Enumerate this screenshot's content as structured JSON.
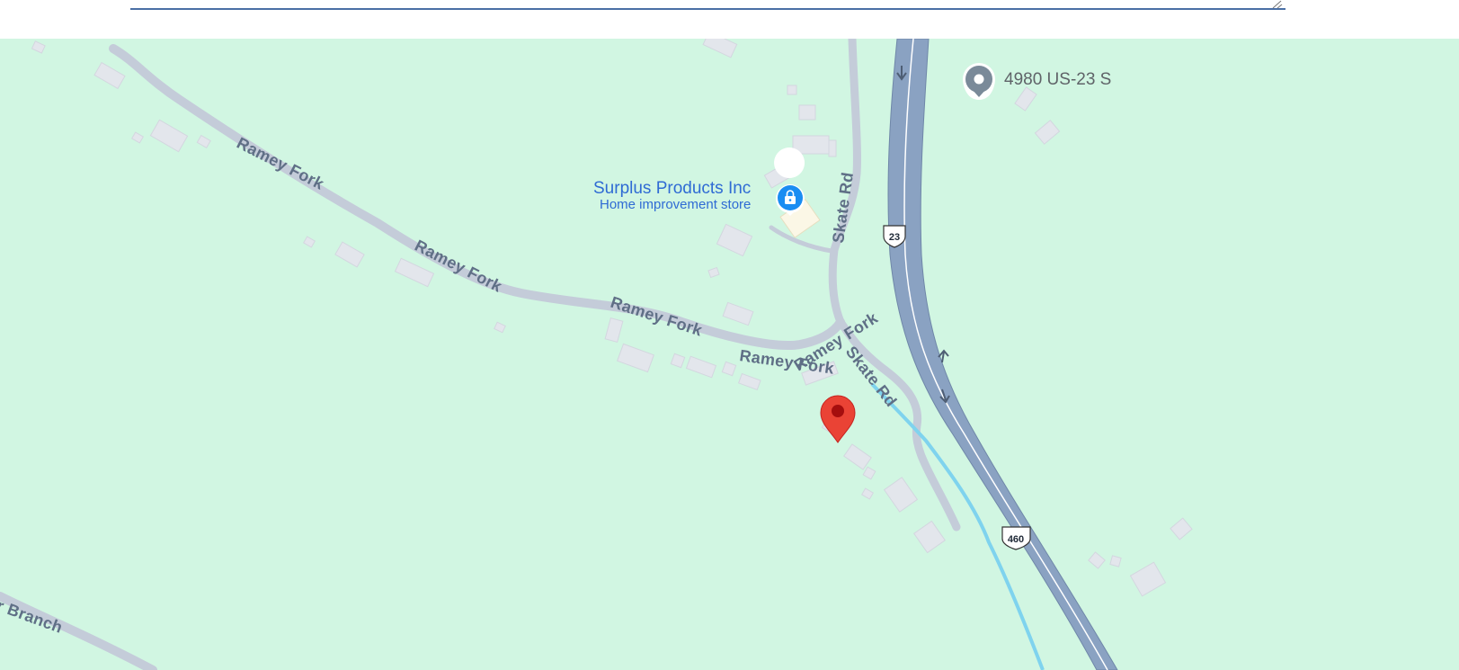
{
  "roads": {
    "ramey_fork": [
      "Ramey Fork",
      "Ramey Fork",
      "Ramey Fork",
      "Ramey Fork",
      "Ramey Fork"
    ],
    "skate_rd": [
      "Skate Rd",
      "Skate Rd"
    ],
    "branch": "r Branch"
  },
  "shields": {
    "us23": "23",
    "us460": "460"
  },
  "places": {
    "store": {
      "name": "Surplus Products Inc",
      "category": "Home improvement store",
      "icon": "shopping-bag-icon",
      "color": "#1a8df2"
    },
    "address_pin": {
      "label": "4980 US-23 S",
      "icon": "location-pin-icon",
      "color": "#7a8a99"
    },
    "dropped_pin": {
      "icon": "map-pin-icon",
      "color": "#ea4335"
    }
  },
  "colors": {
    "land": "#d1f6e2",
    "highway": "#8aa2c2",
    "local_road": "#c4ccd9",
    "stream": "#7fd3ee",
    "building": "#e3e6ec"
  }
}
